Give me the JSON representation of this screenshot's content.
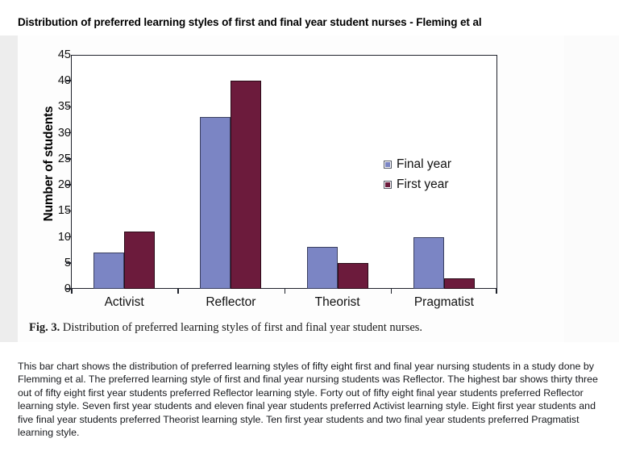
{
  "page_title": "Distribution of preferred learning styles of first and final year student nurses - Fleming et al",
  "figure": {
    "caption_number": "Fig. 3.",
    "caption_text": " Distribution of preferred learning styles of first and final year student nurses."
  },
  "description": "This bar chart shows the distribution of preferred learning styles of fifty eight first and final year nursing students in a study done by Flemming et al.  The preferred learning style of first and final year nursing students was Reflector. The highest bar shows thirty three out of fifty eight first year students preferred Reflector learning style. Forty out of fifty eight final year students preferred Reflector learning style. Seven first year students and eleven final year students preferred Activist learning style. Eight first year students and five final year students preferred Theorist learning style. Ten first year students and two final year students preferred Pragmatist learning style.",
  "colors": {
    "final_year": "#7b85c4",
    "first_year": "#6c1b3c",
    "axis": "#20232c"
  },
  "chart_data": {
    "type": "bar",
    "title": "Distribution of preferred learning styles of first and final year student nurses - Fleming et al",
    "xlabel": "",
    "ylabel": "Number of students",
    "categories": [
      "Activist",
      "Reflector",
      "Theorist",
      "Pragmatist"
    ],
    "series": [
      {
        "name": "Final year",
        "color": "#7b85c4",
        "values": [
          7,
          33,
          8,
          10
        ]
      },
      {
        "name": "First year",
        "color": "#6c1b3c",
        "values": [
          11,
          40,
          5,
          2
        ]
      }
    ],
    "ylim": [
      0,
      45
    ],
    "yticks": [
      0,
      5,
      10,
      15,
      20,
      25,
      30,
      35,
      40,
      45
    ],
    "ytick_labels": [
      "0",
      "5",
      "10",
      "15",
      "20",
      "25",
      "30",
      "35",
      "40",
      "45"
    ],
    "grid": false,
    "legend_position": "inside-upper-right"
  }
}
